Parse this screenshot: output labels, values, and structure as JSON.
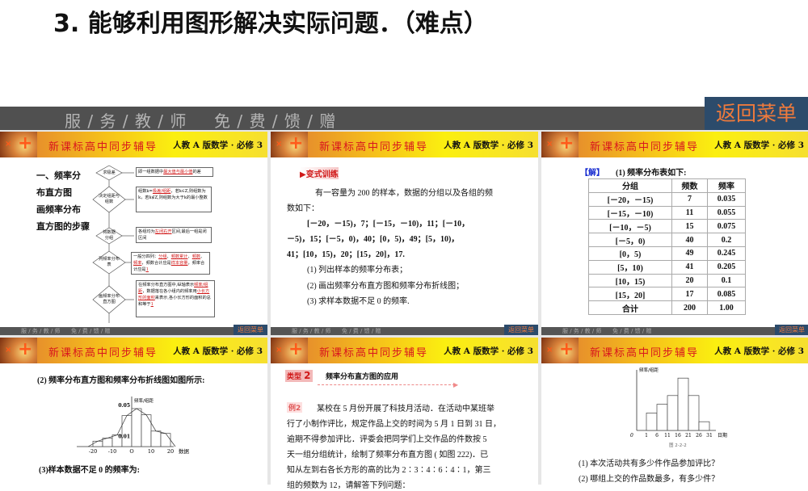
{
  "page_title": "3. 能够利用图形解决实际问题．（难点）",
  "topbar": {
    "left": "服 / 务 / 教 / 师",
    "right": "免 / 费 / 馈 / 赠",
    "menu_button": "返回菜单"
  },
  "slide_header": {
    "series": "新课标高中同步辅导",
    "edition": "人教 A 版数学 · 必修 3"
  },
  "slide_footer": {
    "left": "服 / 务 / 教 / 师",
    "right": "免 / 费 / 馈 / 赠",
    "menu_button": "返回菜单"
  },
  "slide1": {
    "heading_lines": [
      "一、频率分",
      "布直方图",
      "画频率分布",
      "直方图的步骤"
    ],
    "steps": [
      {
        "diamond": "求极差",
        "box": [
          {
            "t": "即一组数据中"
          },
          {
            "t": "最大值与最小值",
            "red": true
          },
          {
            "t": "的差"
          }
        ]
      },
      {
        "diamond": "决定组距与组数",
        "box": [
          {
            "t": "组数k="
          },
          {
            "t": "极差/组距",
            "red": true
          },
          {
            "t": "，若k∈Z,则组数为k，若k∉Z,则组数为大于k的最小整数"
          }
        ]
      },
      {
        "diamond": "将数据分组",
        "box": [
          {
            "t": "各组均为"
          },
          {
            "t": "左闭右开",
            "red": true
          },
          {
            "t": "区间,最后一组是闭区间"
          }
        ]
      },
      {
        "diamond": "列频率分布表",
        "box": [
          {
            "t": "一般分四列："
          },
          {
            "t": "分组",
            "red": true
          },
          {
            "t": "、"
          },
          {
            "t": "频数累计",
            "red": true
          },
          {
            "t": "、"
          },
          {
            "t": "频数",
            "red": true
          },
          {
            "t": "、"
          },
          {
            "t": "频率",
            "red": true
          },
          {
            "t": "，频数合计应是"
          },
          {
            "t": "样本容量",
            "red": true
          },
          {
            "t": "，频率合计应是"
          },
          {
            "t": "1",
            "red": true
          }
        ]
      },
      {
        "diamond": "画频率分布直方图",
        "box": [
          {
            "t": "在频率分布直方图中,纵轴表示"
          },
          {
            "t": "频率/组距",
            "red": true
          },
          {
            "t": "，数据落在各小组内的频率用"
          },
          {
            "t": "小长方形的面积",
            "red": true
          },
          {
            "t": "来表示,各小长方形的面积的总和等于"
          },
          {
            "t": "1",
            "red": true
          }
        ]
      }
    ]
  },
  "slide2": {
    "tag": "变式训练",
    "lines": [
      "有一容量为 200 的样本，数据的分组以及各组的频",
      "数如下：",
      "[－20，－15)，7；[－15，－10)，11；[－10，",
      "－5)，15；[－5，0)，40；[0，5)，49；[5，10)，",
      "41；[10，15)，20；[15，20]，17.",
      "(1) 列出样本的频率分布表；",
      "(2) 画出频率分布直方图和频率分布折线图；",
      "(3) 求样本数据不足 0 的频率."
    ]
  },
  "slide3": {
    "label": "【解】",
    "intro": "(1) 频率分布表如下:",
    "headers": [
      "分组",
      "频数",
      "频率"
    ],
    "rows": [
      [
        "[－20，－15)",
        "7",
        "0.035"
      ],
      [
        "[－15，－10)",
        "11",
        "0.055"
      ],
      [
        "[－10，－5)",
        "15",
        "0.075"
      ],
      [
        "[－5，0)",
        "40",
        "0.2"
      ],
      [
        "[0，5)",
        "49",
        "0.245"
      ],
      [
        "[5，10)",
        "41",
        "0.205"
      ],
      [
        "[10，15)",
        "20",
        "0.1"
      ],
      [
        "[15，20]",
        "17",
        "0.085"
      ],
      [
        "合计",
        "200",
        "1.00"
      ]
    ]
  },
  "slide4": {
    "intro": "(2) 频率分布直方图和频率分布折线图如图所示:",
    "q3": "(3)样本数据不足 0 的频率为:"
  },
  "slide5": {
    "type_badge": "类型",
    "type_num": "2",
    "type_title": "频率分布直方图的应用",
    "example_badge": "例2",
    "lines": [
      "某校在 5 月份开展了科技月活动．在活动中某班举",
      "行了小制作评比，规定作品上交的时间为 5 月 1 日到 31 日，",
      "逾期不得参加评比．评委会把同学们上交作品的件数按 5",
      "天一组分组统计，绘制了频率分布直方图 ( 如图 222)．已",
      "知从左到右各长方形的高的比为 2∶3∶4∶6∶4∶1，第三",
      "组的频数为 12，请解答下列问题："
    ]
  },
  "slide6": {
    "caption": "图 2-2-2",
    "q1": "(1) 本次活动共有多少件作品参加评比？",
    "q2": "(2) 哪组上交的作品数最多，有多少件？"
  },
  "chart_data": [
    {
      "type": "bar",
      "title": "",
      "ylabel": "频率/组距",
      "xlabel": "数据",
      "x_edges": [
        -20,
        -15,
        -10,
        -5,
        0,
        5,
        10,
        15,
        20
      ],
      "values": [
        0.007,
        0.011,
        0.015,
        0.04,
        0.049,
        0.041,
        0.02,
        0.017
      ],
      "xticks": [
        "-20",
        "-10",
        "O",
        "10",
        "20"
      ],
      "xtick_values": [
        -20,
        -10,
        0,
        10,
        20
      ],
      "yticks": [
        "0.01",
        "0.05"
      ],
      "ytick_values": [
        0.01,
        0.05
      ],
      "polyline": true
    },
    {
      "type": "bar",
      "title": "",
      "ylabel": "频率/组距",
      "xlabel": "日期",
      "x_edges": [
        1,
        6,
        11,
        16,
        21,
        26,
        31
      ],
      "values": [
        2,
        3,
        4,
        6,
        4,
        1
      ],
      "xticks": [
        "1",
        "6",
        "11",
        "16",
        "21",
        "26",
        "31"
      ],
      "origin_label": "0"
    }
  ],
  "colors": {
    "accent_red": "#d01818",
    "menu_bg": "#2c4b6b",
    "menu_text": "#ee7a3c",
    "topbar": "#505050"
  }
}
